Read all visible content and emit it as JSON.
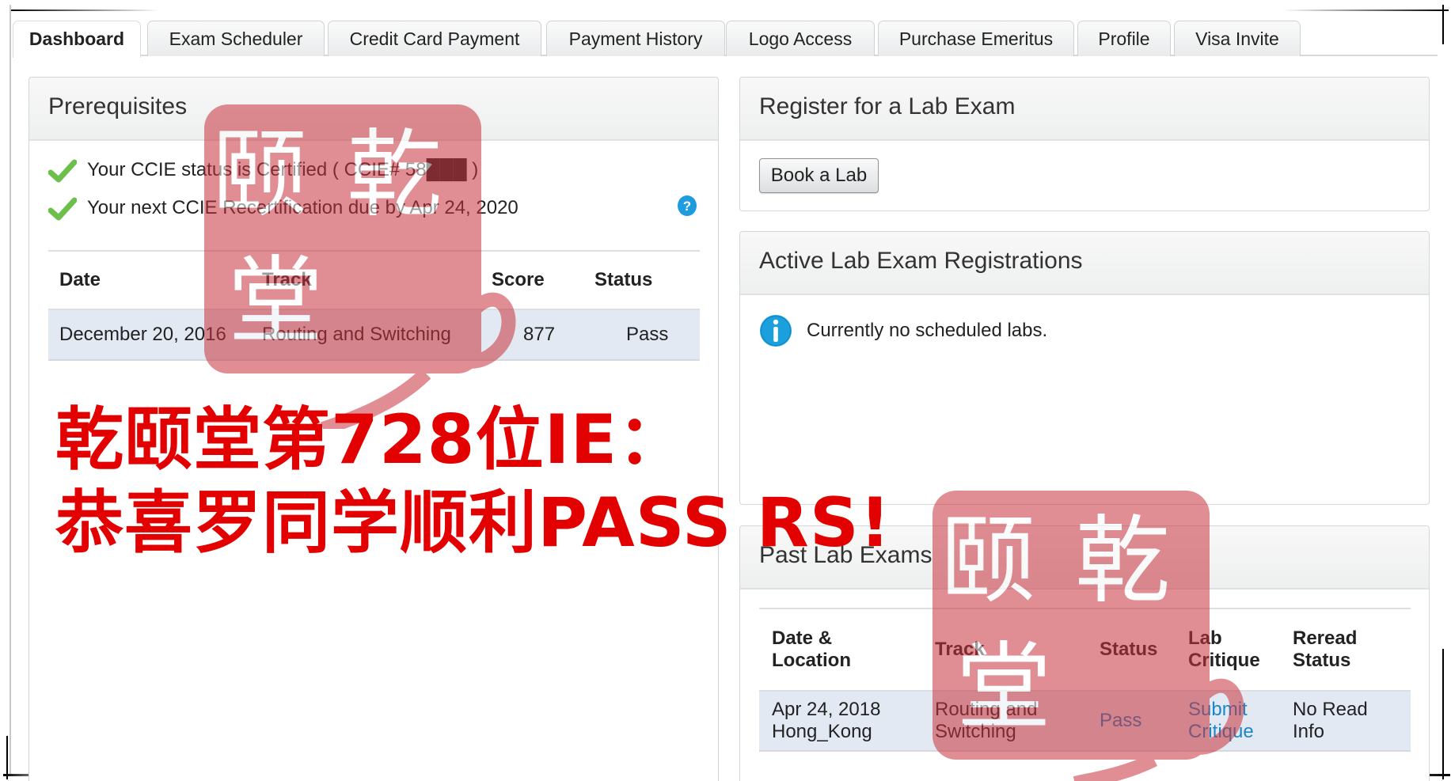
{
  "tabs": [
    {
      "label": "Dashboard",
      "active": true
    },
    {
      "label": "Exam Scheduler",
      "active": false
    },
    {
      "label": "Credit Card Payment",
      "active": false
    },
    {
      "label": "Payment History",
      "active": false
    },
    {
      "label": "Logo Access",
      "active": false
    },
    {
      "label": "Purchase Emeritus",
      "active": false
    },
    {
      "label": "Profile",
      "active": false
    },
    {
      "label": "Visa Invite",
      "active": false
    }
  ],
  "prerequisites": {
    "title": "Prerequisites",
    "status_lines": [
      "Your CCIE status is Certified ( CCIE# 58███ )",
      "Your next CCIE Recertification due by Apr 24, 2020"
    ],
    "help_icon": "question-circle-icon",
    "table": {
      "headers": [
        "Date",
        "Track",
        "Score",
        "Status"
      ],
      "rows": [
        [
          "December 20, 2016",
          "Routing and Switching",
          "877",
          "Pass"
        ]
      ]
    }
  },
  "register": {
    "title": "Register for a Lab Exam",
    "button_label": "Book a Lab"
  },
  "active_registrations": {
    "title": "Active Lab Exam Registrations",
    "message": "Currently no scheduled labs."
  },
  "past_exams": {
    "title": "Past Lab Exams",
    "headers": [
      "Date &\nLocation",
      "Track",
      "Status",
      "Lab\nCritique",
      "Reread\nStatus"
    ],
    "header_lines": [
      [
        "Date &",
        "Location"
      ],
      [
        "Track"
      ],
      [
        "Status"
      ],
      [
        "Lab",
        "Critique"
      ],
      [
        "Reread",
        "Status"
      ]
    ],
    "rows": [
      {
        "date": "Apr 24, 2018",
        "location": "Hong_Kong",
        "track_1": "Routing and",
        "track_2": "Switching",
        "status": "Pass",
        "critique_1": "Submit",
        "critique_2": "Critique",
        "reread_1": "No Read",
        "reread_2": "Info"
      }
    ]
  },
  "overlay": {
    "line1": "乾颐堂第728位IE：",
    "line2": "恭喜罗同学顺利PASS RS!",
    "seal_text": [
      "颐",
      "乾",
      "堂"
    ],
    "color": "#e30000",
    "seal_color": "#c8323c"
  },
  "colors": {
    "link": "#1a86c8",
    "check": "#6cc04a",
    "info": "#1ba0dd",
    "row_bg": "#e3e9f2"
  }
}
